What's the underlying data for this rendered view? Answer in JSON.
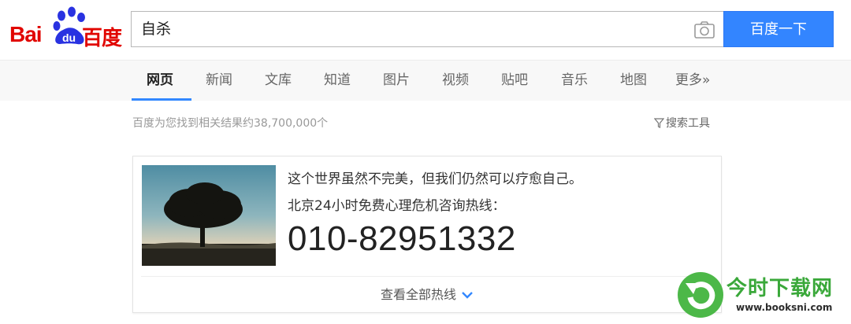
{
  "logo": {
    "left_text": "Bai",
    "paw_text": "du",
    "right_text": "百度"
  },
  "search": {
    "query": "自杀",
    "button_label": "百度一下"
  },
  "tabs": [
    {
      "label": "网页",
      "active": true
    },
    {
      "label": "新闻",
      "active": false
    },
    {
      "label": "文库",
      "active": false
    },
    {
      "label": "知道",
      "active": false
    },
    {
      "label": "图片",
      "active": false
    },
    {
      "label": "视频",
      "active": false
    },
    {
      "label": "贴吧",
      "active": false
    },
    {
      "label": "音乐",
      "active": false
    },
    {
      "label": "地图",
      "active": false
    },
    {
      "label": "更多»",
      "active": false
    }
  ],
  "results": {
    "count_text": "百度为您找到相关结果约38,700,000个",
    "tools_label": "搜索工具"
  },
  "card": {
    "line1": "这个世界虽然不完美，但我们仍然可以疗愈自己。",
    "line2": "北京24小时免费心理危机咨询热线：",
    "number": "010-82951332",
    "view_all": "查看全部热线"
  },
  "watermark": {
    "title": "今时下载网",
    "url": "www.booksni.com"
  },
  "colors": {
    "brand_red": "#e10601",
    "brand_blue": "#3385ff",
    "accent_blue": "#3388ff"
  }
}
